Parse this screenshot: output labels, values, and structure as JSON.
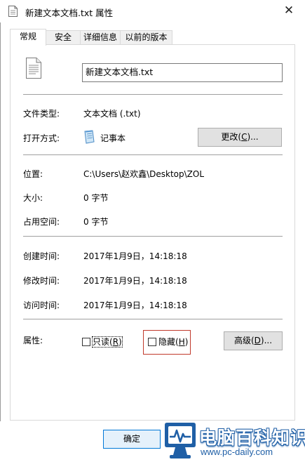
{
  "window": {
    "title": "新建文本文档.txt 属性",
    "close_glyph": "✕"
  },
  "tabs": [
    {
      "label": "常规",
      "active": true
    },
    {
      "label": "安全",
      "active": false
    },
    {
      "label": "详细信息",
      "active": false
    },
    {
      "label": "以前的版本",
      "active": false
    }
  ],
  "general": {
    "file_name": "新建文本文档.txt",
    "type_label": "文件类型:",
    "type_value": "文本文档 (.txt)",
    "open_with_label": "打开方式:",
    "open_with_value": "记事本",
    "change_button": {
      "text": "更改(",
      "key": "C",
      "suffix": ")..."
    },
    "location_label": "位置:",
    "location_value": "C:\\Users\\赵欢鑫\\Desktop\\ZOL",
    "size_label": "大小:",
    "size_value": "0 字节",
    "disk_size_label": "占用空间:",
    "disk_size_value": "0 字节",
    "created_label": "创建时间:",
    "created_value": "2017年1月9日，14:18:18",
    "modified_label": "修改时间:",
    "modified_value": "2017年1月9日，14:18:18",
    "accessed_label": "访问时间:",
    "accessed_value": "2017年1月9日，14:18:18",
    "attributes_label": "属性:",
    "readonly": {
      "text": "只读(",
      "key": "R",
      "suffix": ")",
      "checked": false
    },
    "hidden": {
      "text": "隐藏(",
      "key": "H",
      "suffix": ")",
      "checked": false
    },
    "advanced_button": {
      "text": "高级(",
      "key": "D",
      "suffix": ")..."
    }
  },
  "footer": {
    "ok_label": "确定"
  },
  "watermark": {
    "title": "电脑百科知识",
    "url": "www.pc-daily.com"
  },
  "colors": {
    "accent": "#0078d7",
    "highlight": "#c0392b",
    "watermark_blue": "#1f5fa6"
  }
}
